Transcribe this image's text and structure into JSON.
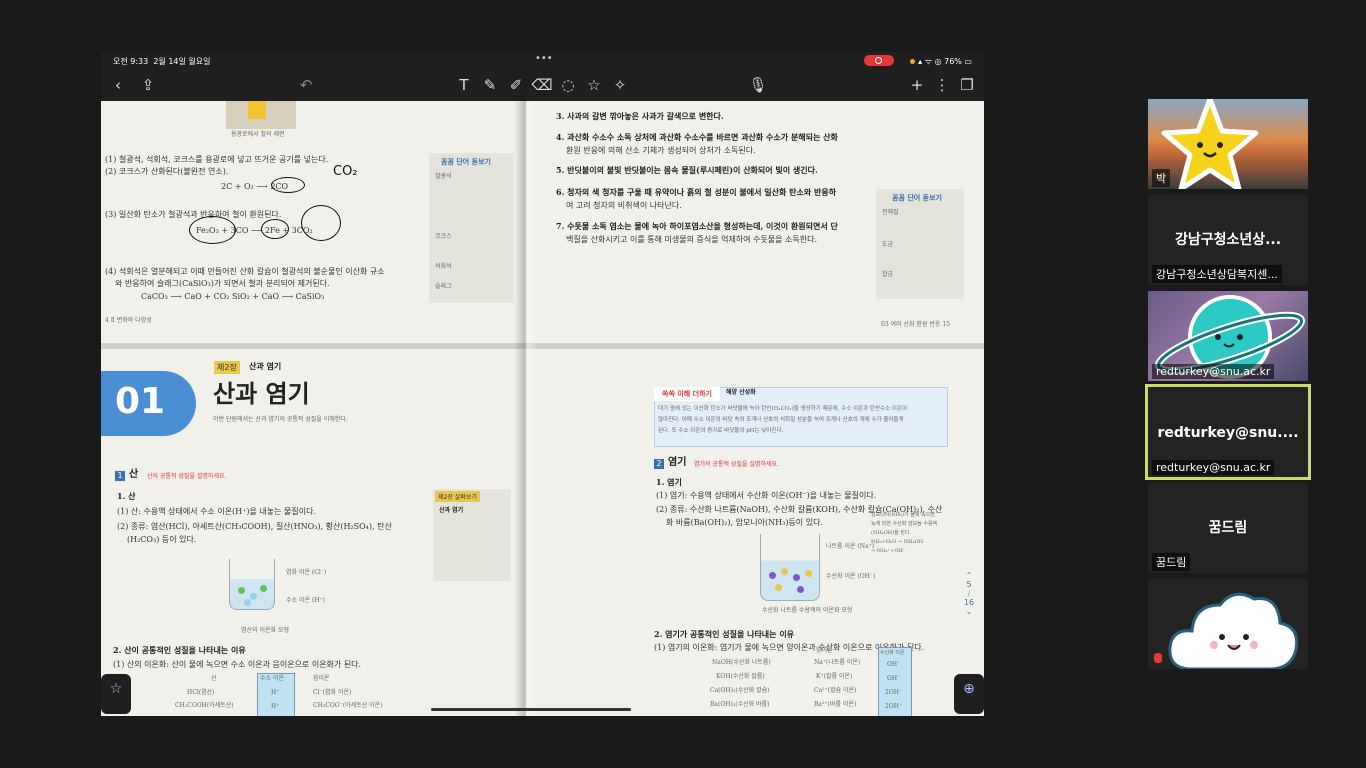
{
  "status_bar": {
    "time": "오전 9:33",
    "date": "2월 14일 월요일",
    "battery": "76%"
  },
  "toolbar": {
    "back": "‹",
    "share": "⇪",
    "undo": "↶",
    "text_tool": "T",
    "add": "+",
    "more": "⋮"
  },
  "document": {
    "page_indicator": {
      "current": "5",
      "total": "16"
    },
    "top_left": {
      "lines": [
        "(1) 철광석, 석회석, 코크스를 용광로에 넣고 뜨거운 공기를 넣는다.",
        "(2) 코크스가 산화된다(불완전 연소).",
        "2C + O₂ ⟶ 2CO",
        "(3) 일산화 탄소가 철광석과 반응하여 철이 환원된다.",
        "Fe₂O₃ + 3CO ⟶ 2Fe + 3CO₂",
        "(4) 석회석은 열분해되고 이때 만들어진 산화 칼슘이 철광석의 불순물인 이산화 규소",
        "와 반응하여 슬래그(CaSiO₃)가 되면서 철과 분리되어 제거된다.",
        "CaCO₃ ⟶ CaO + CO₂        SiO₂ + CaO ⟶ CaSiO₃"
      ],
      "handwriting": "CO₂",
      "caption": "용광로에서 철의 제련",
      "side_title": "꼼꼼 단어 돋보기",
      "side_items": [
        "철광석",
        "코크스",
        "석회석",
        "슬래그"
      ],
      "footer": "4  Ⅱ 변화와 다양성"
    },
    "top_right": {
      "lines": [
        "3. 사과의 갈변  깎아놓은 사과가 갈색으로 변한다.",
        "4. 과산화 수소수 소독  상처에 과산화 수소수를 바르면 과산화 수소가 분해되는 산화",
        "환원 반응에 의해 산소 기체가 생성되어 상처가 소독된다.",
        "5. 반딧불이의 불빛  반딧불이는 몸속 물질(루시페린)이 산화되어 빛이 생긴다.",
        "6. 청자의 색  청자를 구울 때 유약이나 흙의 철 성분이 불에서 일산화 탄소와 반응하",
        "여 고려 청자의 비취색이 나타난다.",
        "7. 수돗물 소독  염소는 물에 녹아 하이포염소산을 형성하는데, 이것이 환원되면서 단",
        "백질을 산화시키고 이를 통해 미생물의 증식을 억제하여 수돗물을 소독한다."
      ],
      "side_title": "꼼꼼 단어 돋보기",
      "side_items": [
        "전해질",
        "도금",
        "합금"
      ],
      "footer": "03 여러 산화 환원 반응  15"
    },
    "bottom_left": {
      "chapter_num": "01",
      "chapter_tag": "제2장",
      "chapter_tag_label": "산과 염기",
      "title": "산과 염기",
      "subtitle": "이번 단원에서는 산과 염기의 공통적 성질을 이해한다.",
      "section_num": "1",
      "section_title": "산",
      "section_note": "산의 공통적 성질을 설명하세요.",
      "lines": [
        "1. 산",
        "(1) 산: 수용액 상태에서 수소 이온(H⁺)을 내놓는 물질이다.",
        "(2) 종류: 염산(HCl), 아세트산(CH₃COOH), 질산(HNO₃), 황산(H₂SO₄), 탄산",
        "(H₂CO₃) 등이 있다."
      ],
      "side_tag": "제2장 살펴보기",
      "side_title": "산과 염기",
      "ion_label_1": "염화 이온 (Cl⁻)",
      "ion_label_2": "수소 이온 (H⁺)",
      "beaker_caption": "염산의 이온화 모형",
      "section2_title": "2. 산이 공통적인 성질을 나타내는 이유",
      "section2_line": "(1) 산의 이온화: 산이 물에 녹으면 수소 이온과 음이온으로 이온화가 된다.",
      "table_rows": [
        "산",
        "HCl(염산)",
        "CH₃COOH(아세트산)"
      ],
      "table_header": "수소 이온",
      "table_h": [
        "H⁺",
        "H⁺"
      ],
      "table_anion_header": "음이온",
      "table_anion": [
        "Cl⁻(염화 이온)",
        "CH₃COO⁻(아세트산 이온)"
      ]
    },
    "bottom_right": {
      "info_tab": "쏙쏙 이해 더하기",
      "info_title": "해양 산성화",
      "info_text": [
        "대기 중에 있는 이산화 탄소가 바닷물에 녹아 탄산(H₂CO₃)을 생성하기 때문에, 수소 이온과 탄산수소 이온이",
        "많아진다. 이때 수소 이온의 바닷 속의 조개나 산호의 석회질 성분을 녹여 조개나 산호의 개체 수가 줄어들게",
        "된다. 또 수소 이온의 증가로 바닷물의 pH는 낮아진다."
      ],
      "section_num": "2",
      "section_title": "염기",
      "section_note": "염기의 공통적 성질을 설명하세요.",
      "lines": [
        "1. 염기",
        "(1) 염기: 수용액 상태에서 수산화 이온(OH⁻)을 내놓는 물질이다.",
        "(2) 종류: 수산화 나트륨(NaOH), 수산화 칼륨(KOH), 수산화 칼슘(Ca(OH)₂), 수산",
        "화 바륨(Ba(OH)₂), 암모니아(NH₃)등이 있다."
      ],
      "ion_label_1": "나트륨 이온 (Na⁺)",
      "ion_label_2": "수산화 이온 (OH⁻)",
      "beaker_caption": "수산화 나트륨 수용액의 이온화 모형",
      "side_note": [
        "암모니아(NH₃)가 물에 녹으면",
        "녹게 되면 수산화 암모늄 수용액",
        "(NH₄OH)을 된다.",
        "NH₃+H₂O → NH₄OH",
        "→ NH₄⁺+OH⁻"
      ],
      "section2_title": "2. 염기가 공통적인 성질을 나타내는 이유",
      "section2_line": "(1) 염기의 이온화: 염기가 물에 녹으면 양이온과 수산화 이온으로 이온화가 된다.",
      "table_rows": [
        "NaOH(수산화 나트륨)",
        "KOH(수산화 칼륨)",
        "Ca(OH)₂(수산화 칼슘)",
        "Ba(OH)₂(수산화 바륨)"
      ],
      "table_cation_header": "양이온",
      "table_cations": [
        "Na⁺(나트륨 이온)",
        "K⁺(칼륨 이온)",
        "Ca²⁺(칼슘 이온)",
        "Ba²⁺(바륨 이온)"
      ],
      "table_header": "수산화 이온",
      "table_oh": [
        "OH⁻",
        "OH⁻",
        "2OH⁻",
        "2OH⁻"
      ]
    }
  },
  "participants": [
    {
      "name": "박",
      "type": "video",
      "sticker": "star"
    },
    {
      "name": "강남구청소년상담복지센...",
      "display": "강남구청소년상...",
      "type": "name"
    },
    {
      "name": "redturkey@snu.ac.kr",
      "type": "video",
      "sticker": "planet"
    },
    {
      "name": "redturkey@snu.ac.kr",
      "display": "redturkey@snu....",
      "type": "name",
      "active": true
    },
    {
      "name": "꿈드림",
      "display": "꿈드림",
      "type": "name"
    },
    {
      "name": "",
      "type": "sticker",
      "sticker": "cloud",
      "muted": true
    }
  ],
  "colors": {
    "accent_blue": "#4a8fd4",
    "record_red": "#e53935",
    "active_speaker": "#c9dc6b"
  }
}
